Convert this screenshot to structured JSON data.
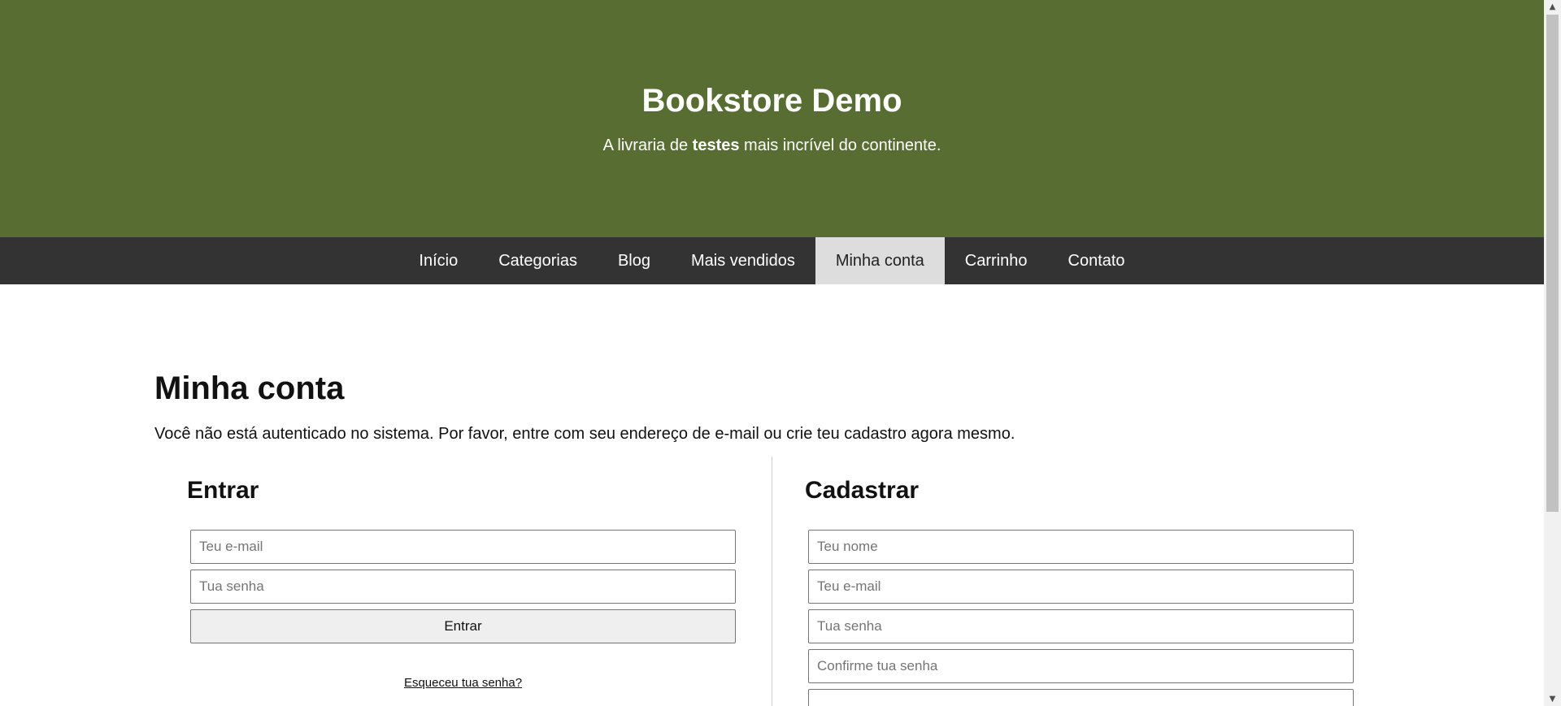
{
  "header": {
    "title": "Bookstore Demo",
    "tagline_before": "A livraria de ",
    "tagline_bold": "testes",
    "tagline_after": " mais incrível do continente."
  },
  "nav": {
    "items": [
      {
        "label": "Início"
      },
      {
        "label": "Categorias"
      },
      {
        "label": "Blog"
      },
      {
        "label": "Mais vendidos"
      },
      {
        "label": "Minha conta",
        "active": true
      },
      {
        "label": "Carrinho"
      },
      {
        "label": "Contato"
      }
    ]
  },
  "main": {
    "title": "Minha conta",
    "intro": "Você não está autenticado no sistema. Por favor, entre com seu endereço de e-mail ou crie teu cadastro agora mesmo."
  },
  "login": {
    "heading": "Entrar",
    "email_placeholder": "Teu e-mail",
    "password_placeholder": "Tua senha",
    "submit_label": "Entrar",
    "forgot_label": "Esqueceu tua senha?"
  },
  "register": {
    "heading": "Cadastrar",
    "name_placeholder": "Teu nome",
    "email_placeholder": "Teu e-mail",
    "password_placeholder": "Tua senha",
    "confirm_placeholder": "Confirme tua senha"
  },
  "colors": {
    "hero_bg": "#586d31",
    "nav_bg": "#333333",
    "nav_active_bg": "#dddddd"
  }
}
